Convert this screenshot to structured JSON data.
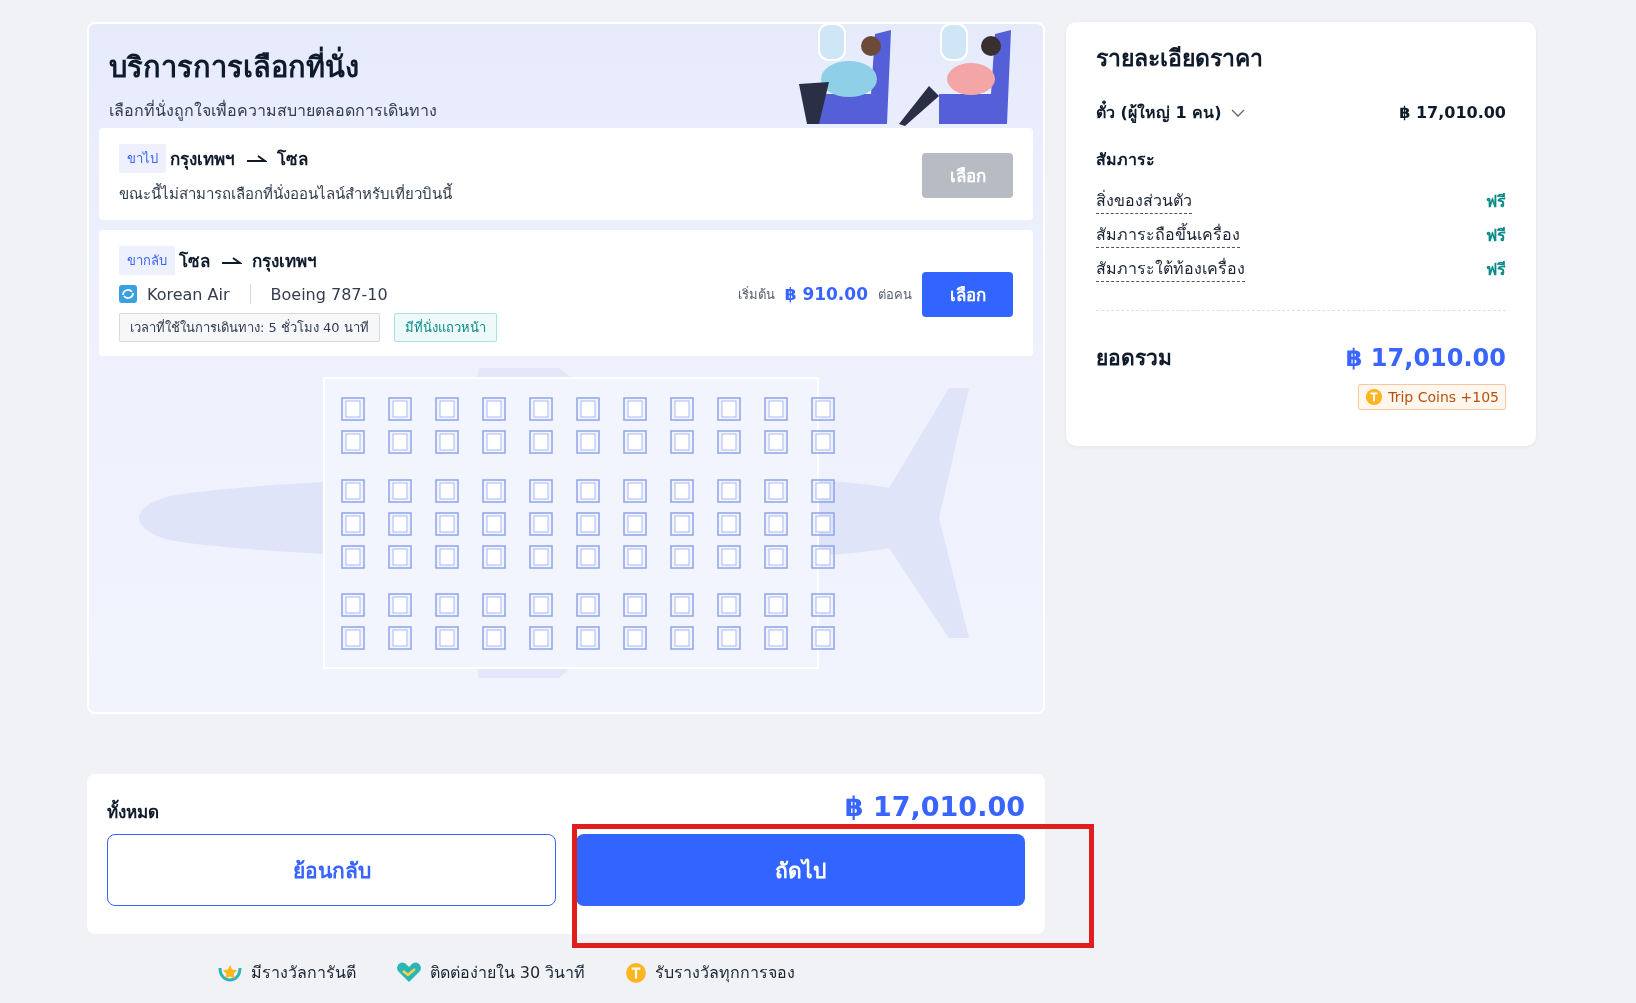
{
  "seat_service": {
    "title": "บริการการเลือกที่นั่ง",
    "subtitle": "เลือกที่นั่งถูกใจเพื่อความสบายตลอดการเดินทาง",
    "flights": [
      {
        "direction": "ขาไป",
        "origin": "กรุงเทพฯ",
        "destination": "โซล",
        "note": "ขณะนี้ไม่สามารถเลือกที่นั่งออนไลน์สำหรับเที่ยวบินนี้",
        "button": "เลือก",
        "disabled": true
      },
      {
        "direction": "ขากลับ",
        "origin": "โซล",
        "destination": "กรุงเทพฯ",
        "airline": "Korean Air",
        "aircraft": "Boeing 787-10",
        "price_prefix": "เริ่มต้น",
        "price": "฿ 910.00",
        "price_suffix": "ต่อคน",
        "button": "เลือก",
        "disabled": false,
        "tags": [
          {
            "label": "เวลาที่ใช้ในการเดินทาง: 5 ชั่วโมง 40 นาที",
            "kind": "info"
          },
          {
            "label": "มีที่นั่งแถวหน้า",
            "kind": "highlight"
          }
        ]
      }
    ]
  },
  "price_details": {
    "title": "รายละเอียดราคา",
    "ticket_label": "ตั๋ว (ผู้ใหญ่ 1 คน)",
    "ticket_price": "฿ 17,010.00",
    "baggage_heading": "สัมภาระ",
    "baggage": [
      {
        "label": "สิ่งของส่วนตัว",
        "value": "ฟรี"
      },
      {
        "label": "สัมภาระถือขึ้นเครื่อง",
        "value": "ฟรี"
      },
      {
        "label": "สัมภาระใต้ท้องเครื่อง",
        "value": "ฟรี"
      }
    ],
    "total_label": "ยอดรวม",
    "total": "฿ 17,010.00",
    "coins": "Trip Coins +105"
  },
  "summary": {
    "label": "ทั้งหมด",
    "total": "฿ 17,010.00",
    "back_button": "ย้อนกลับ",
    "next_button": "ถัดไป",
    "highlighted": true
  },
  "features": [
    {
      "label": "มีรางวัลการันตี",
      "kind": "award"
    },
    {
      "label": "ติดต่อง่ายใน 30 วินาที",
      "kind": "contact"
    },
    {
      "label": "รับรางวัลทุกการจอง",
      "kind": "coin"
    }
  ]
}
